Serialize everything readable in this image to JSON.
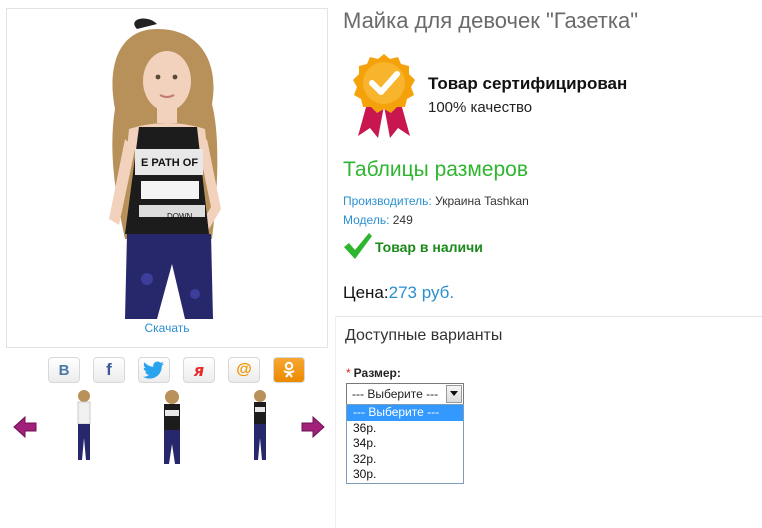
{
  "product": {
    "title": "Майка для девочек \"Газетка\"",
    "download_label": "Скачать"
  },
  "certificate": {
    "title": "Товар сертифицирован",
    "subtitle": "100% качество",
    "icon": "certified-badge-icon",
    "colors": {
      "gold": "#f5a20a",
      "ribbon": "#c8174e"
    }
  },
  "size_tables_label": "Таблицы размеров",
  "meta": {
    "manufacturer_key": "Производитель:",
    "manufacturer_value": "Украина Tashkan",
    "model_key": "Модель:",
    "model_value": "249"
  },
  "stock": {
    "label": "Товар в наличи",
    "icon": "checkmark-icon"
  },
  "price": {
    "label": "Цена:",
    "value": "273 руб."
  },
  "variants": {
    "title": "Доступные варианты",
    "size_label": "Размер:",
    "required_mark": "*",
    "selected": "--- Выберите ---",
    "options": [
      "--- Выберите ---",
      "36р.",
      "34р.",
      "32р.",
      "30р."
    ]
  },
  "share": [
    {
      "name": "vk",
      "glyph": "B",
      "color": "#4a76a8"
    },
    {
      "name": "facebook",
      "glyph": "f",
      "color": "#3b5998"
    },
    {
      "name": "twitter",
      "glyph": "twitter-bird",
      "color": "#2aa3ef"
    },
    {
      "name": "yaru",
      "glyph": "я",
      "color": "#e52b2b"
    },
    {
      "name": "mailru",
      "glyph": "@",
      "color": "#f29400"
    },
    {
      "name": "odnoklassniki",
      "glyph": "ok",
      "color": "#f28a00"
    }
  ],
  "colors": {
    "link": "#2a8fd0",
    "accent_green": "#2fb52f",
    "stock_green": "#1b8a1b",
    "nav_arrow": "#a0207a"
  }
}
